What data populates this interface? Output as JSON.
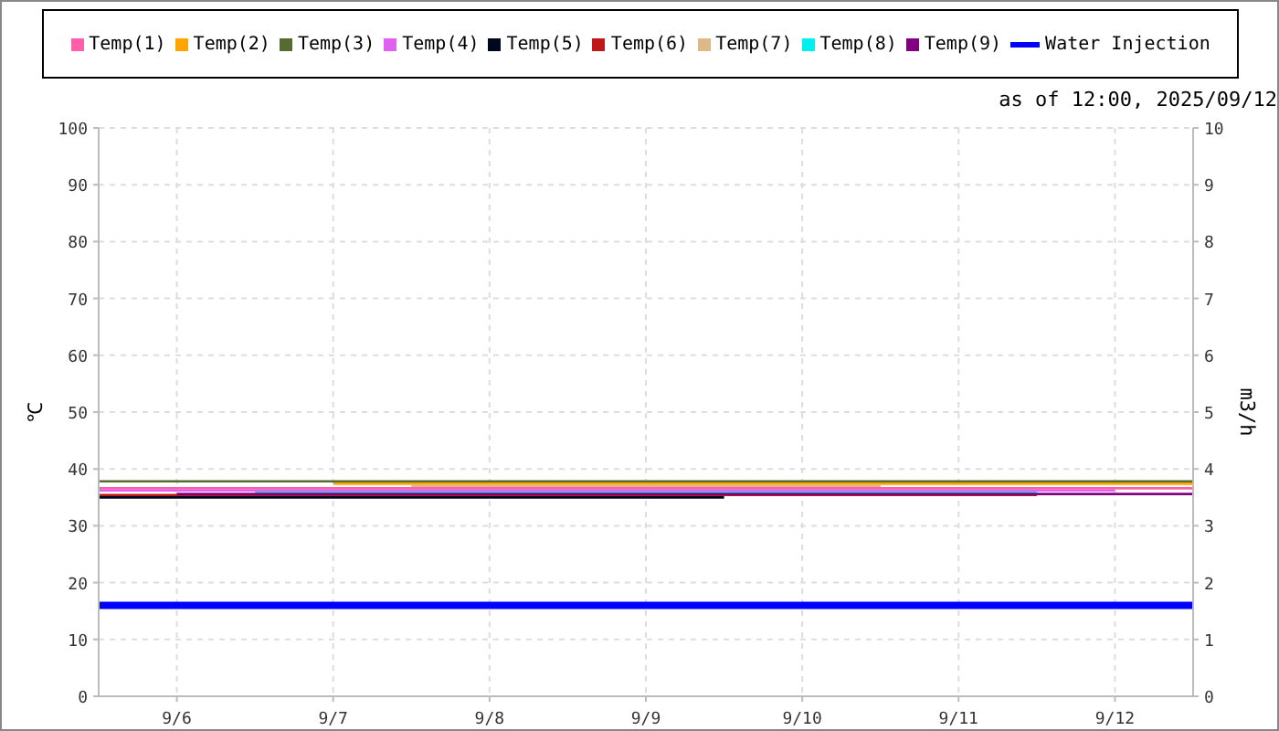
{
  "timestamp": "as of 12:00, 2025/09/12",
  "chart_data": {
    "type": "line",
    "grid": true,
    "ylabel": "℃",
    "y2label": "m3/h",
    "categories": [
      null,
      "9/6",
      null,
      "9/7",
      null,
      "9/8",
      null,
      "9/9",
      null,
      "9/10",
      null,
      "9/11",
      null,
      "9/12",
      null
    ],
    "ylim": [
      0,
      100
    ],
    "y2lim": [
      0,
      10
    ],
    "yticks": [
      0,
      10,
      20,
      30,
      40,
      50,
      60,
      70,
      80,
      90,
      100
    ],
    "y2ticks": [
      0,
      1,
      2,
      3,
      4,
      5,
      6,
      7,
      8,
      9,
      10
    ],
    "series": [
      {
        "name": "Temp(1)",
        "color": "#ff5fa8",
        "values": [
          36.6,
          36.6,
          36.6,
          36.6,
          36.6,
          36.6,
          36.6,
          36.6,
          36.6,
          36.6,
          36.6,
          36.6,
          36.6,
          36.6,
          36.6
        ]
      },
      {
        "name": "Temp(2)",
        "color": "#ffa500",
        "values": [
          null,
          null,
          null,
          37.4,
          37.4,
          37.4,
          37.4,
          37.4,
          37.4,
          37.4,
          37.4,
          37.4,
          37.4,
          37.4,
          37.4
        ]
      },
      {
        "name": "Temp(3)",
        "color": "#556b2f",
        "values": [
          37.8,
          37.8,
          37.8,
          37.8,
          37.8,
          37.8,
          37.8,
          37.8,
          37.8,
          37.8,
          37.8,
          37.8,
          37.8,
          37.8,
          37.8
        ]
      },
      {
        "name": "Temp(4)",
        "color": "#e060f0",
        "values": [
          36.2,
          36.2,
          36.2,
          36.2,
          36.2,
          36.2,
          36.2,
          36.2,
          36.2,
          36.2,
          36.2,
          36.2,
          36.2,
          36.2,
          null
        ]
      },
      {
        "name": "Temp(5)",
        "color": "#000820",
        "values": [
          35.0,
          35.0,
          35.0,
          35.0,
          35.0,
          35.0,
          35.0,
          35.0,
          35.0,
          null,
          null,
          null,
          null,
          null,
          null
        ]
      },
      {
        "name": "Temp(6)",
        "color": "#c01818",
        "values": [
          35.4,
          35.4,
          35.4,
          35.4,
          35.4,
          35.4,
          35.4,
          35.4,
          35.4,
          35.4,
          35.4,
          35.4,
          35.4,
          null,
          null
        ]
      },
      {
        "name": "Temp(7)",
        "color": "#deb887",
        "values": [
          null,
          null,
          null,
          null,
          37.0,
          37.0,
          37.0,
          37.0,
          37.0,
          37.0,
          37.0,
          null,
          null,
          null,
          null
        ]
      },
      {
        "name": "Temp(8)",
        "color": "#00f0f0",
        "values": [
          null,
          null,
          35.8,
          35.8,
          35.8,
          35.8,
          35.8,
          35.8,
          35.8,
          35.8,
          35.8,
          35.8,
          35.8,
          null,
          null
        ]
      },
      {
        "name": "Temp(9)",
        "color": "#800080",
        "values": [
          null,
          35.6,
          35.6,
          35.6,
          35.6,
          35.6,
          35.6,
          35.6,
          35.6,
          35.6,
          35.6,
          35.6,
          35.6,
          35.6,
          35.6
        ]
      },
      {
        "name": "Water Injection",
        "color": "#0000ff",
        "axis": "y2",
        "values": [
          1.6,
          1.6,
          1.6,
          1.6,
          1.6,
          1.6,
          1.6,
          1.6,
          1.6,
          1.6,
          1.6,
          1.6,
          1.6,
          1.6,
          1.6
        ]
      }
    ]
  }
}
